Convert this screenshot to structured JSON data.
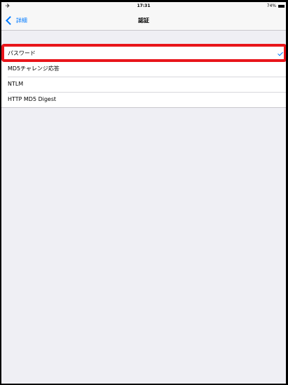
{
  "status_bar": {
    "airplane_icon": "airplane-icon",
    "time": "17:31",
    "battery_percent": "74%"
  },
  "nav": {
    "back_label": "詳細",
    "title": "認証"
  },
  "options": [
    {
      "label": "パスワード",
      "selected": true
    },
    {
      "label": "MD5チャレンジ応答",
      "selected": false
    },
    {
      "label": "NTLM",
      "selected": false
    },
    {
      "label": "HTTP MD5 Digest",
      "selected": false
    }
  ],
  "colors": {
    "accent": "#007aff",
    "highlight": "#e8151b",
    "background": "#efeff4"
  }
}
